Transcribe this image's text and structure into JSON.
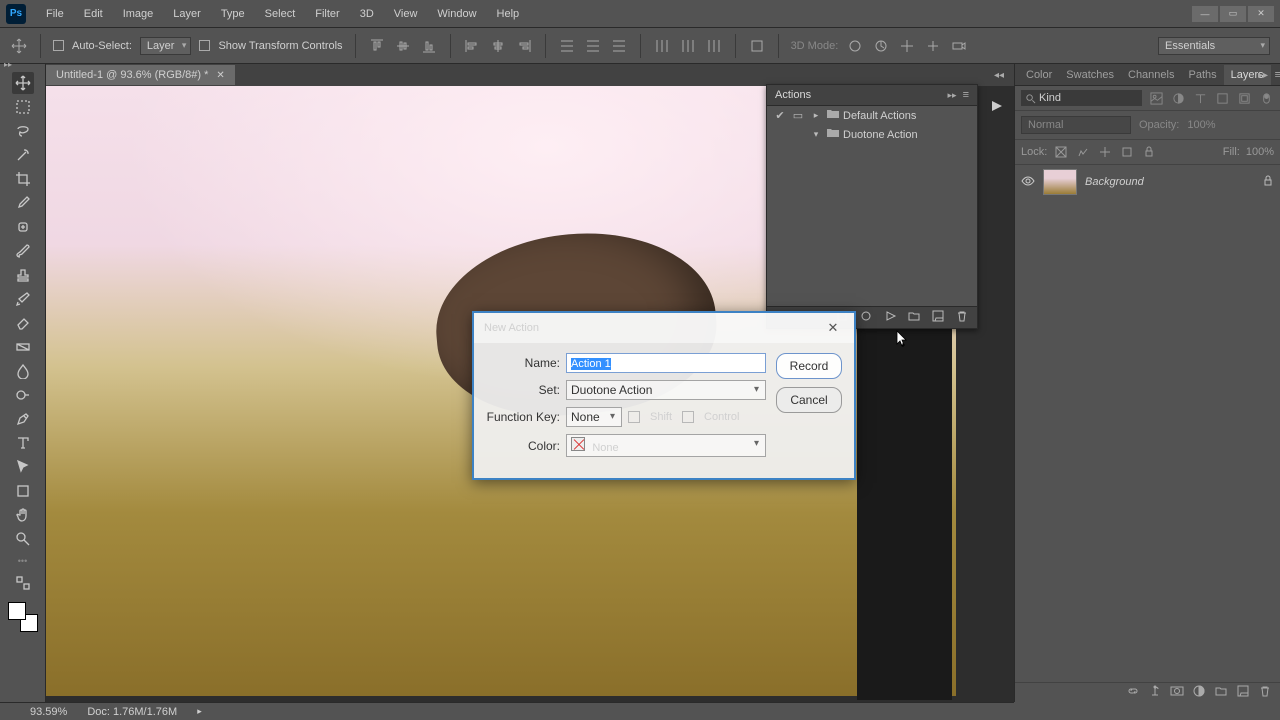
{
  "menu": {
    "items": [
      "File",
      "Edit",
      "Image",
      "Layer",
      "Type",
      "Select",
      "Filter",
      "3D",
      "View",
      "Window",
      "Help"
    ]
  },
  "optionsbar": {
    "auto_select": "Auto-Select:",
    "layer_sel": "Layer",
    "show_transform": "Show Transform Controls",
    "mode_3d": "3D Mode:",
    "workspace": "Essentials"
  },
  "document": {
    "tab": "Untitled-1 @ 93.6% (RGB/8#) *"
  },
  "actions_panel": {
    "title": "Actions",
    "rows": [
      {
        "checked": true,
        "expanded": false,
        "label": "Default Actions"
      },
      {
        "checked": false,
        "expanded": true,
        "label": "Duotone Action"
      }
    ]
  },
  "right_panel": {
    "tabs": [
      "Color",
      "Swatches",
      "Channels",
      "Paths",
      "Layers"
    ],
    "active_tab": "Layers",
    "kind": "Kind",
    "blend_mode": "Normal",
    "opacity_lbl": "Opacity:",
    "opacity_val": "100%",
    "lock_lbl": "Lock:",
    "fill_lbl": "Fill:",
    "fill_val": "100%",
    "layer": {
      "name": "Background"
    }
  },
  "dialog": {
    "title": "New Action",
    "name_lbl": "Name:",
    "name_val": "Action 1",
    "set_lbl": "Set:",
    "set_val": "Duotone Action",
    "fk_lbl": "Function Key:",
    "fk_val": "None",
    "shift": "Shift",
    "control": "Control",
    "color_lbl": "Color:",
    "color_val": "None",
    "record": "Record",
    "cancel": "Cancel"
  },
  "status": {
    "zoom": "93.59%",
    "doc_size": "Doc: 1.76M/1.76M"
  }
}
